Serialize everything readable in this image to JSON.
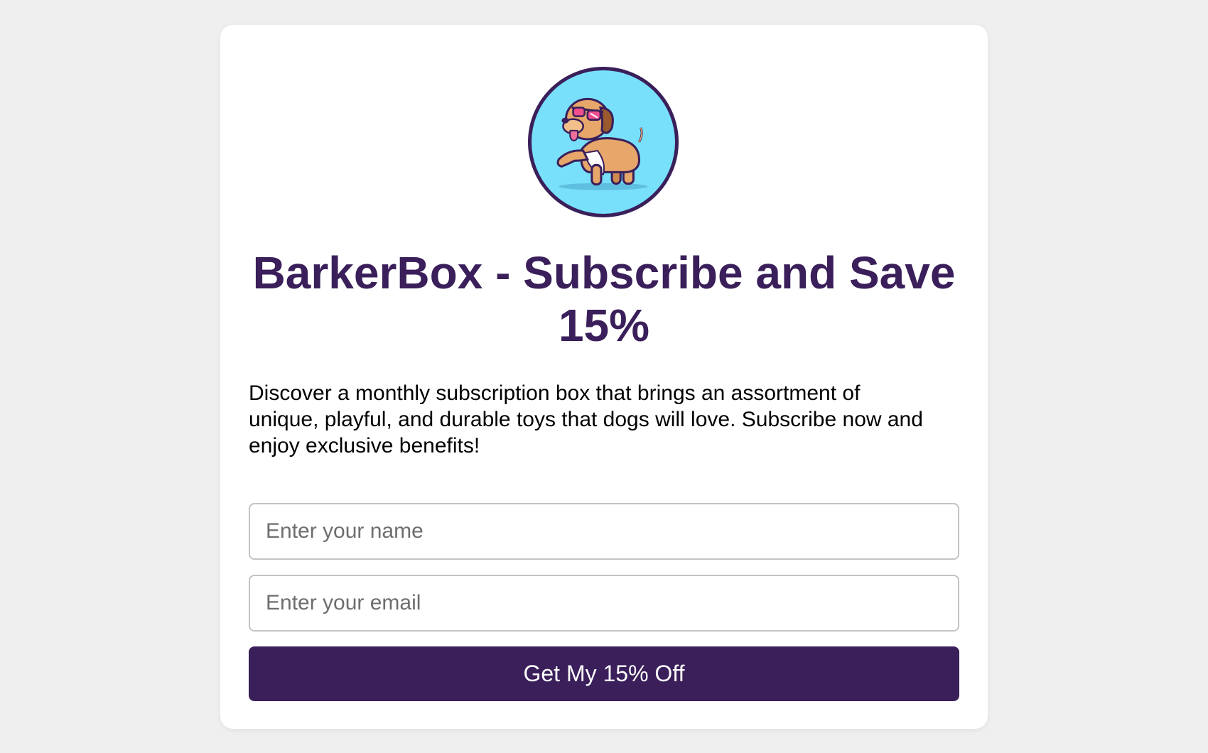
{
  "brand": {
    "logo_icon": "cartoon-dog-with-sunglasses-icon",
    "accent_color": "#3a1f5a",
    "logo_background": "#78e0fb"
  },
  "hero": {
    "title": "BarkerBox - Subscribe and Save 15%",
    "description": "Discover a monthly subscription box that brings an assortment of unique, playful, and durable toys that dogs will love. Subscribe now and enjoy exclusive benefits!"
  },
  "form": {
    "name_placeholder": "Enter your name",
    "name_value": "",
    "email_placeholder": "Enter your email",
    "email_value": "",
    "submit_label": "Get My 15% Off"
  }
}
